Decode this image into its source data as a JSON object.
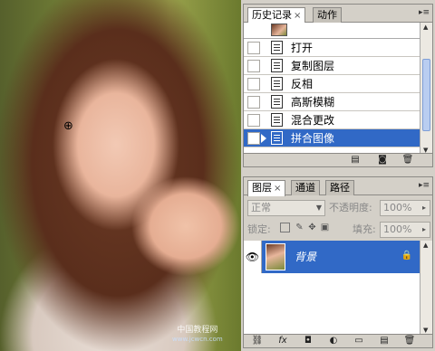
{
  "canvas": {
    "watermark_line1": "中国教程网",
    "watermark_line2": "www.jcwcn.com"
  },
  "history_panel": {
    "tabs": [
      {
        "label": "历史记录",
        "close": "×"
      },
      {
        "label": "动作"
      }
    ],
    "items": [
      {
        "label": "打开"
      },
      {
        "label": "复制图层"
      },
      {
        "label": "反相"
      },
      {
        "label": "高斯模糊"
      },
      {
        "label": "混合更改"
      },
      {
        "label": "拼合图像",
        "selected": true
      }
    ]
  },
  "layers_panel": {
    "tabs": [
      {
        "label": "图层",
        "close": "×"
      },
      {
        "label": "通道"
      },
      {
        "label": "路径"
      }
    ],
    "blend_mode": "正常",
    "opacity_label": "不透明度:",
    "opacity_value": "100%",
    "lock_label": "锁定:",
    "fill_label": "填充:",
    "fill_value": "100%",
    "layers": [
      {
        "name": "背景",
        "visible": true,
        "locked": true,
        "selected": true
      }
    ]
  }
}
